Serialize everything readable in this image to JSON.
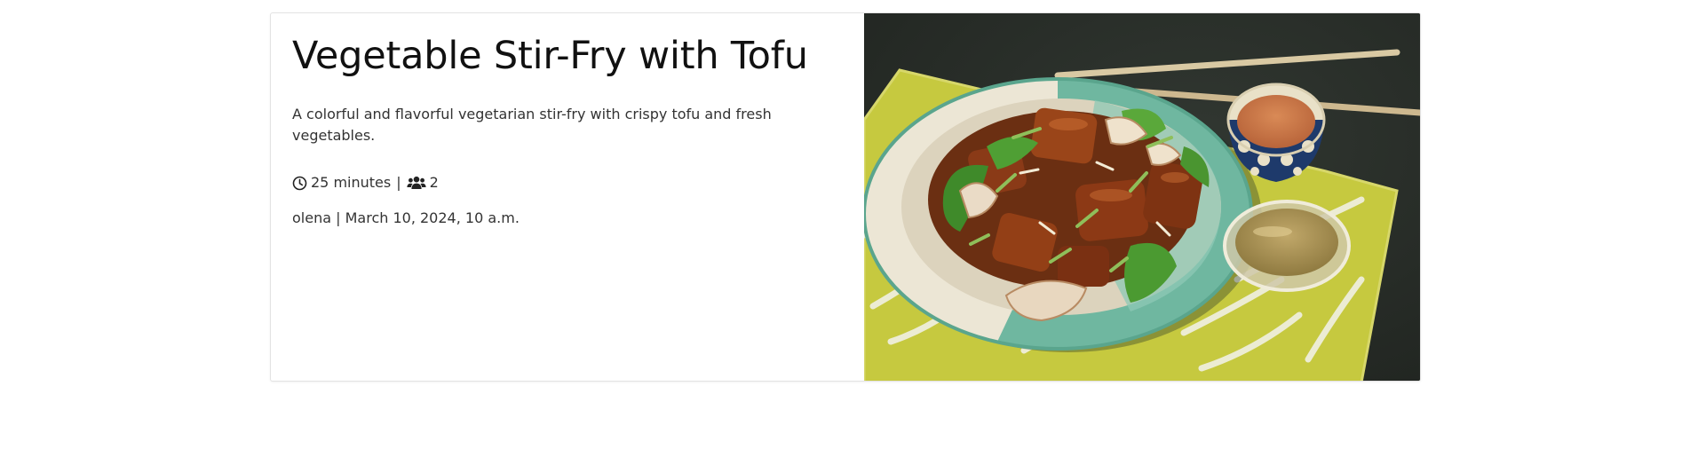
{
  "recipe": {
    "title": "Vegetable Stir-Fry with Tofu",
    "description": "A colorful and flavorful vegetarian stir-fry with crispy tofu and fresh vegetables.",
    "cook_time": "25 minutes",
    "separator": "|",
    "servings": "2",
    "author": "olena",
    "date": "March 10, 2024, 10 a.m.",
    "time_icon": "clock-icon",
    "servings_icon": "users-icon",
    "image_alt": "Vegetable Stir-Fry with Tofu"
  }
}
